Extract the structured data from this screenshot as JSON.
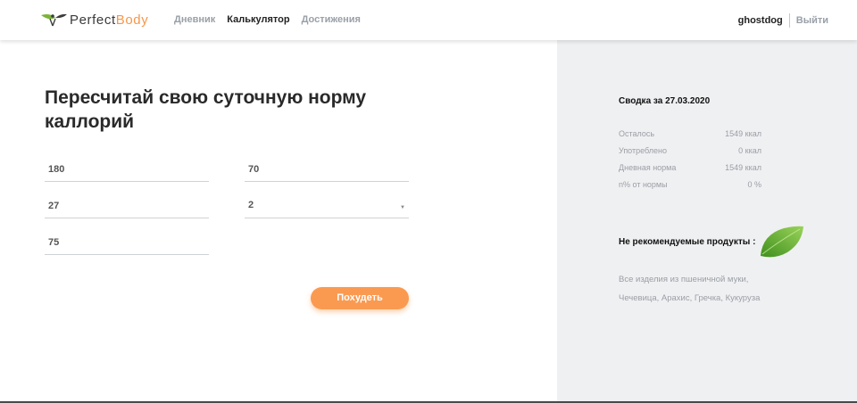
{
  "brand": {
    "name_part1": "Perfect",
    "name_part2": "Body",
    "accent_color": "#f7964a"
  },
  "nav": {
    "items": [
      {
        "label": "Дневник",
        "active": false
      },
      {
        "label": "Калькулятор",
        "active": true
      },
      {
        "label": "Достижения",
        "active": false
      }
    ]
  },
  "user": {
    "name": "ghostdog",
    "logout_label": "Выйти"
  },
  "main": {
    "title": "Пересчитай свою суточную норму каллорий",
    "fields": {
      "height": "180",
      "weight": "70",
      "age": "27",
      "activity": "2",
      "target_weight": "75"
    },
    "submit_label": "Похудеть",
    "button_color": "#fa9a50"
  },
  "summary": {
    "title": "Сводка за 27.03.2020",
    "stats": [
      {
        "label": "Осталось",
        "value": "1549 ккал"
      },
      {
        "label": "Употреблено",
        "value": "0 ккал"
      },
      {
        "label": "Дневная норма",
        "value": "1549 ккал"
      },
      {
        "label": "n% от нормы",
        "value": "0 %"
      }
    ],
    "not_recommended_title": "Не рекомендуемые продукты :",
    "not_recommended_lines": [
      "Все изделия из пшеничной муки,",
      "Чечевица, Арахис, Гречка, Кукуруза"
    ],
    "leaf_icon": "leaf-icon"
  }
}
